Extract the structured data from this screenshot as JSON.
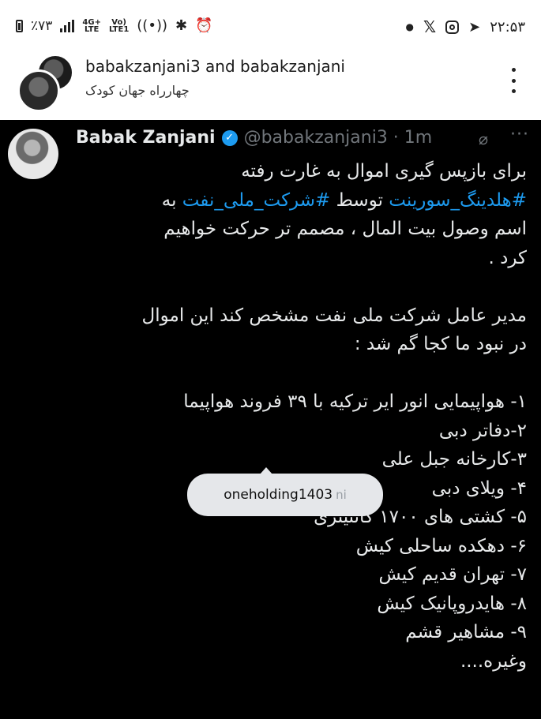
{
  "status_bar": {
    "battery": "٪۷۳",
    "network_small_top": "4G+",
    "network_small_bottom": "LTE",
    "volte_top": "Vo)",
    "volte_bottom": "LTE1",
    "time": "۲۲:۵۳"
  },
  "header": {
    "title": "babakzanjani3 and babakzanjani",
    "subtitle": "چهارراه جهان کودک"
  },
  "tweet": {
    "display_name": "Babak Zanjani",
    "handle_time": "@babakzanjani3 · 1m",
    "more_glyph": "···",
    "lines": [
      "برای بازپس گیری اموال به غارت رفته",
      "",
      "اسم وصول بیت المال ، مصمم تر حرکت خواهیم",
      "کرد .",
      "",
      "مدیر عامل شرکت ملی نفت مشخص کند این اموال",
      "در نبود ما کجا گم شد :",
      "",
      "۱- هواپیمایی انور ایر ترکیه با ۳۹ فروند هواپیما",
      "۲-دفاتر دبی",
      "۳-کارخانه جبل علی",
      "۴- ویلای دبی",
      "۵- کشتی های ۱۷۰۰ کانتینری",
      "۶- دهکده ساحلی کیش",
      "۷- تهران قدیم کیش",
      "۸- هایدروپانیک کیش",
      "۹- مشاهیر قشم",
      "وغیره...."
    ],
    "hashtag_line": {
      "hashtag1": "#هلدینگ_سورینت",
      "middle": " توسط ",
      "hashtag2": "#شرکت_ملی_نفت",
      "tail": "  به"
    }
  },
  "tooltip": {
    "label": "oneholding1403",
    "faded": "ni"
  },
  "colors": {
    "tweet_bg": "#000000",
    "hashtag": "#1d9bf0",
    "verified": "#1d9bf0",
    "muted": "#71767b"
  }
}
